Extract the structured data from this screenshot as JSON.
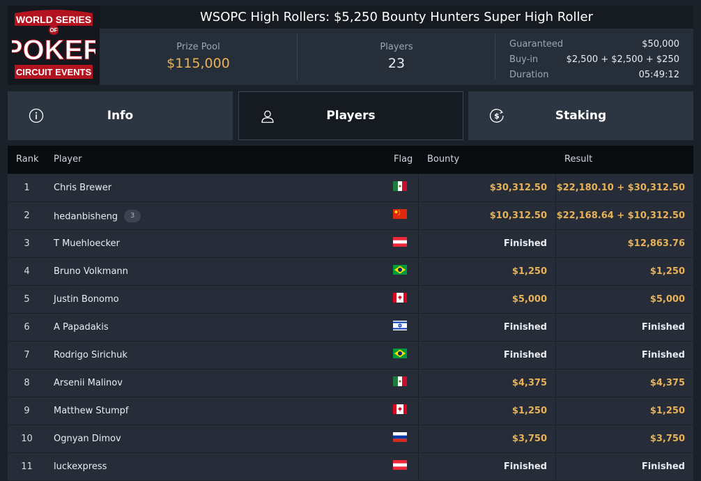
{
  "logo": {
    "line1": "WORLD SERIES",
    "line2": "OF",
    "line3": "POKER",
    "line4": "CIRCUIT EVENTS"
  },
  "title": "WSOPC High Rollers: $5,250 Bounty Hunters Super High Roller",
  "stats": {
    "prize_pool_label": "Prize Pool",
    "prize_pool_value": "$115,000",
    "players_label": "Players",
    "players_value": "23",
    "guaranteed_label": "Guaranteed",
    "guaranteed_value": "$50,000",
    "buyin_label": "Buy-in",
    "buyin_value": "$2,500 + $2,500 + $250",
    "duration_label": "Duration",
    "duration_value": "05:49:12"
  },
  "tabs": [
    {
      "label": "Info",
      "icon": "info-icon",
      "active": false
    },
    {
      "label": "Players",
      "icon": "user-icon",
      "active": true
    },
    {
      "label": "Staking",
      "icon": "dollar-coin-icon",
      "active": false
    }
  ],
  "table": {
    "headers": {
      "rank": "Rank",
      "player": "Player",
      "flag": "Flag",
      "bounty": "Bounty",
      "result": "Result"
    },
    "rows": [
      {
        "rank": "1",
        "player": "Chris Brewer",
        "badge": "",
        "flag": "mx",
        "bounty": "$30,312.50",
        "result": "$22,180.10 + $30,312.50"
      },
      {
        "rank": "2",
        "player": "hedanbisheng",
        "badge": "3",
        "flag": "cn",
        "bounty": "$10,312.50",
        "result": "$22,168.64 + $10,312.50"
      },
      {
        "rank": "3",
        "player": "T Muehloecker",
        "badge": "",
        "flag": "at",
        "bounty": "Finished",
        "result": "$12,863.76"
      },
      {
        "rank": "4",
        "player": "Bruno Volkmann",
        "badge": "",
        "flag": "br",
        "bounty": "$1,250",
        "result": "$1,250"
      },
      {
        "rank": "5",
        "player": "Justin Bonomo",
        "badge": "",
        "flag": "ca",
        "bounty": "$5,000",
        "result": "$5,000"
      },
      {
        "rank": "6",
        "player": "A Papadakis",
        "badge": "",
        "flag": "il",
        "bounty": "Finished",
        "result": "Finished"
      },
      {
        "rank": "7",
        "player": "Rodrigo Sirichuk",
        "badge": "",
        "flag": "br",
        "bounty": "Finished",
        "result": "Finished"
      },
      {
        "rank": "8",
        "player": "Arsenii Malinov",
        "badge": "",
        "flag": "mx",
        "bounty": "$4,375",
        "result": "$4,375"
      },
      {
        "rank": "9",
        "player": "Matthew Stumpf",
        "badge": "",
        "flag": "ca",
        "bounty": "$1,250",
        "result": "$1,250"
      },
      {
        "rank": "10",
        "player": "Ognyan Dimov",
        "badge": "",
        "flag": "ru",
        "bounty": "$3,750",
        "result": "$3,750"
      },
      {
        "rank": "11",
        "player": "luckexpress",
        "badge": "",
        "flag": "at",
        "bounty": "Finished",
        "result": "Finished"
      }
    ]
  },
  "colors": {
    "accent_gold": "#e8b256",
    "background": "#1b2129",
    "panel": "#262e3a"
  }
}
